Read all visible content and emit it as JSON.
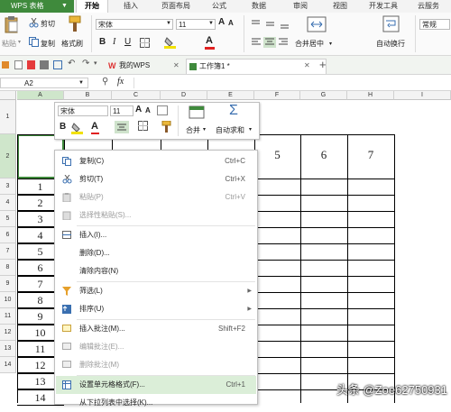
{
  "app": {
    "name": "WPS 表格"
  },
  "menu_tabs": [
    "开始",
    "插入",
    "页面布局",
    "公式",
    "数据",
    "审阅",
    "视图",
    "开发工具",
    "云服务"
  ],
  "ribbon": {
    "paste": "粘贴",
    "cut": "剪切",
    "copy": "复制",
    "format_painter": "格式刷",
    "font_name": "宋体",
    "font_size": "11",
    "merge_center": "合并居中",
    "wrap_text": "自动换行",
    "number_format": "常规"
  },
  "doc_tabs": [
    "我的WPS",
    "工作簿1 *"
  ],
  "formula_bar": {
    "cell_ref": "A2",
    "fx": "fx"
  },
  "columns": [
    "A",
    "B",
    "C",
    "D",
    "E",
    "F",
    "G",
    "H",
    "I"
  ],
  "rows": [
    "1",
    "2",
    "3",
    "4",
    "5",
    "6",
    "7",
    "8",
    "9",
    "10",
    "11",
    "12",
    "13",
    "14"
  ],
  "column_a_values": [
    "1",
    "2",
    "3",
    "4",
    "5",
    "6",
    "7",
    "8",
    "9",
    "10",
    "11",
    "12",
    "13",
    "14"
  ],
  "header_numbers": [
    "5",
    "6",
    "7"
  ],
  "mini_toolbar": {
    "font_name": "宋体",
    "font_size": "11",
    "merge": "合并",
    "autosum": "自动求和"
  },
  "context_menu": [
    {
      "label": "复制(C)",
      "shortcut": "Ctrl+C",
      "icon": "copy-icon"
    },
    {
      "label": "剪切(T)",
      "shortcut": "Ctrl+X",
      "icon": "scissors-icon"
    },
    {
      "label": "粘贴(P)",
      "shortcut": "Ctrl+V",
      "icon": "paste-icon"
    },
    {
      "label": "选择性粘贴(S)...",
      "shortcut": "",
      "icon": "paste-special-icon"
    },
    {
      "label": "插入(I)...",
      "shortcut": "",
      "icon": "insert-icon"
    },
    {
      "label": "删除(D)...",
      "shortcut": "",
      "icon": ""
    },
    {
      "label": "清除内容(N)",
      "shortcut": "",
      "icon": ""
    },
    {
      "label": "筛选(L)",
      "shortcut": "",
      "icon": "filter-icon"
    },
    {
      "label": "排序(U)",
      "shortcut": "",
      "icon": "sort-icon"
    },
    {
      "label": "插入批注(M)...",
      "shortcut": "Shift+F2",
      "icon": "comment-icon"
    },
    {
      "label": "编辑批注(E)...",
      "shortcut": "",
      "icon": "edit-comment-icon"
    },
    {
      "label": "删除批注(M)",
      "shortcut": "",
      "icon": "delete-comment-icon"
    },
    {
      "label": "设置单元格格式(F)...",
      "shortcut": "Ctrl+1",
      "icon": "format-cells-icon"
    },
    {
      "label": "从下拉列表中选择(K)...",
      "shortcut": "",
      "icon": ""
    }
  ],
  "watermark": "头条 @Zoe62750931",
  "colors": {
    "accent_green": "#3f8a3c",
    "highlight": "#dbeed8"
  }
}
